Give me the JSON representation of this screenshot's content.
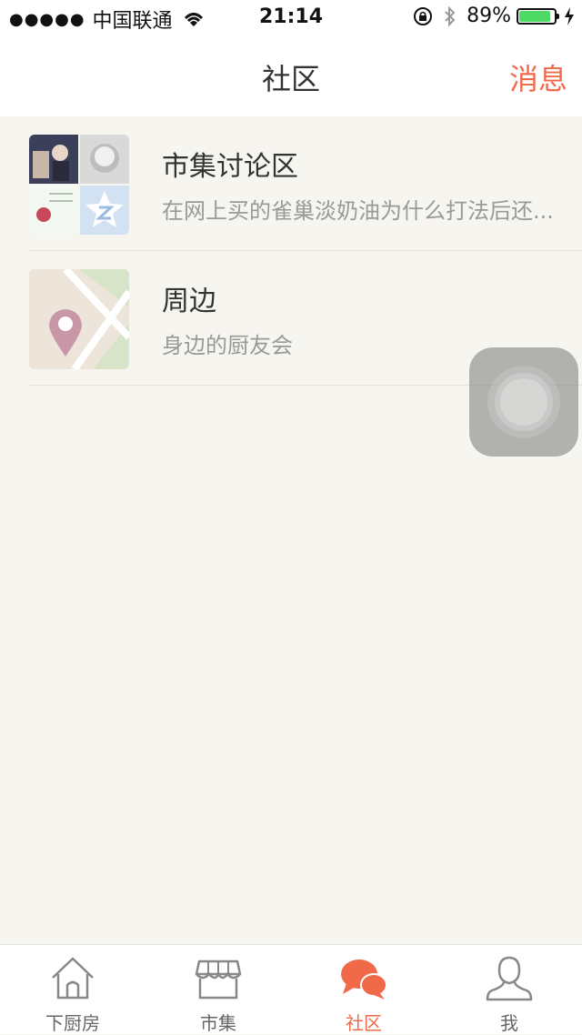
{
  "status_bar": {
    "signal": "●●●●●",
    "carrier": "中国联通",
    "time": "21:14",
    "battery_percent": "89%",
    "battery_level": 0.89
  },
  "nav": {
    "title": "社区",
    "message_button": "消息"
  },
  "list": [
    {
      "title": "市集讨论区",
      "subtitle": "在网上买的雀巢淡奶油为什么打法后还..."
    },
    {
      "title": "周边",
      "subtitle": "身边的厨友会"
    }
  ],
  "tabs": [
    {
      "label": "下厨房",
      "icon": "house-icon",
      "active": false
    },
    {
      "label": "市集",
      "icon": "shop-icon",
      "active": false
    },
    {
      "label": "社区",
      "icon": "chat-bubbles-icon",
      "active": true
    },
    {
      "label": "我",
      "icon": "person-icon",
      "active": false
    }
  ],
  "colors": {
    "accent": "#f06a4a",
    "background": "#f6f5ef"
  }
}
